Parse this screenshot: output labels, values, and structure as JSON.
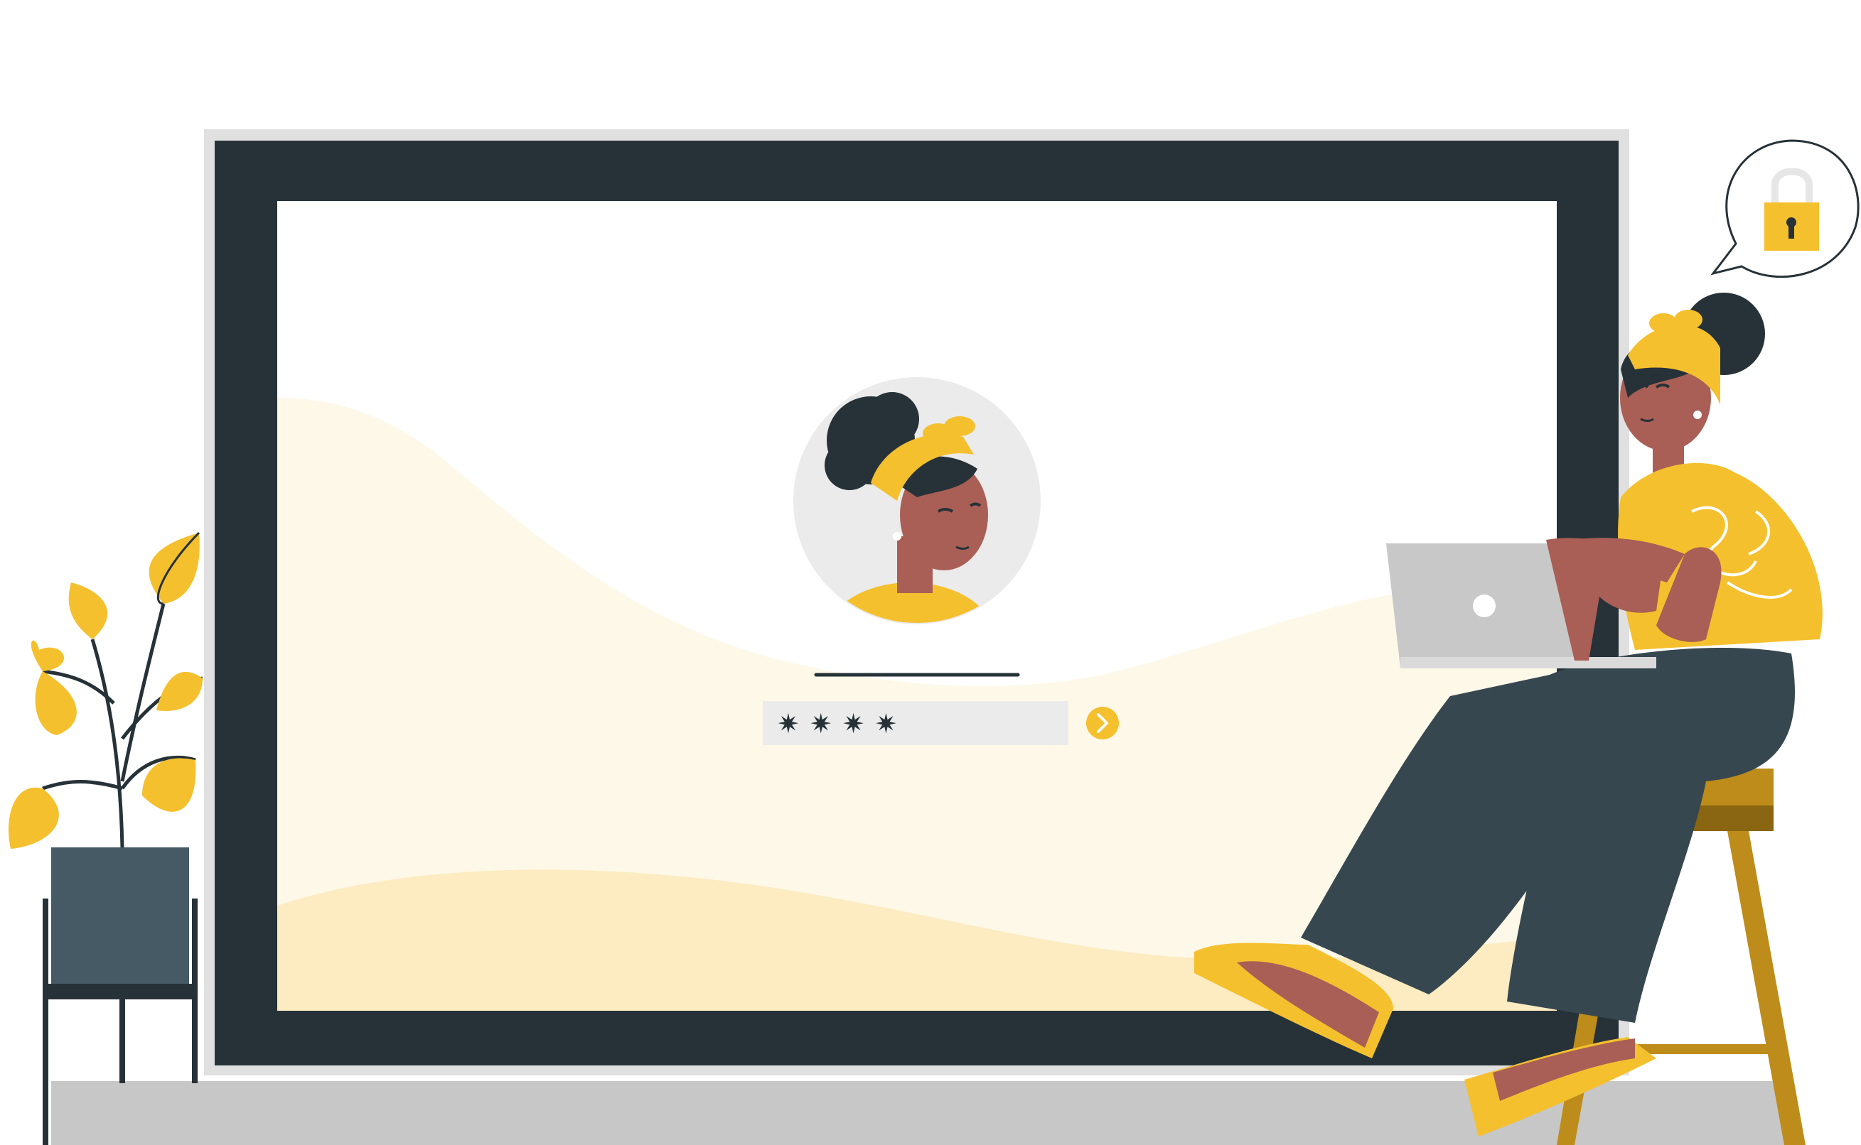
{
  "login": {
    "password_mask": "✷✷✷✷",
    "submit_icon": "chevron-right-icon",
    "avatar_icon": "user-avatar"
  },
  "speech_bubble": {
    "icon": "padlock-icon"
  },
  "colors": {
    "frame": "#263238",
    "frame_border": "#e0e0e0",
    "screen": "#ffffff",
    "accent": "#f5c02e",
    "wave_light": "#fef8e8",
    "wave_mid": "#fdecc2",
    "floor": "#c7c7c7",
    "skin": "#a95f55",
    "pants": "#37474f",
    "stool": "#bd8c1a",
    "laptop": "#c8c8c8",
    "input_bg": "#ebebeb",
    "plant_pot": "#455a64"
  }
}
